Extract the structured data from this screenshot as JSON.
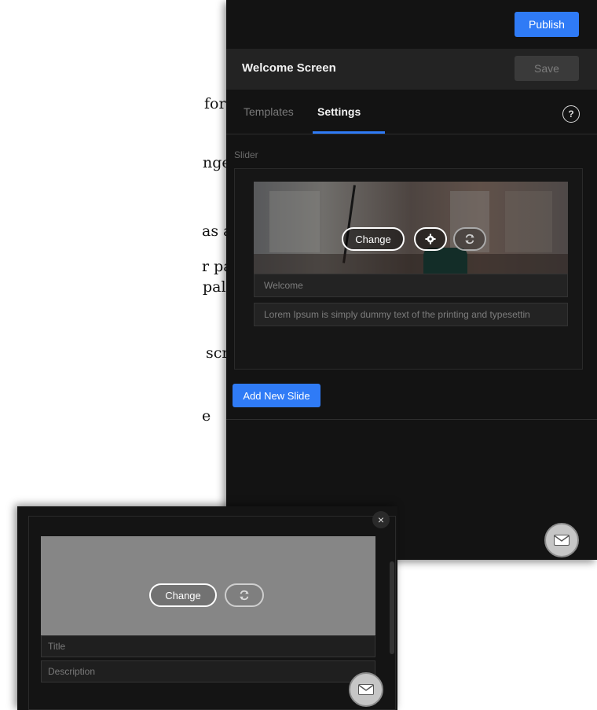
{
  "doc_lines": [
    "for your mobile",
    "nge and the text",
    " as and when",
    "r palette",
    " palette to sync",
    "screen.",
    "e"
  ],
  "main_panel": {
    "publish_label": "Publish",
    "header_title": "Welcome Screen",
    "save_label": "Save",
    "tabs": [
      {
        "label": "Templates",
        "active": false
      },
      {
        "label": "Settings",
        "active": true
      }
    ],
    "help_icon": "?",
    "section_label": "Slider",
    "slide": {
      "change_label": "Change",
      "gear_icon": "gear-icon",
      "refresh_icon": "refresh-icon",
      "title_value": "Welcome",
      "description_value": "Lorem Ipsum is simply dummy text of the printing and typesettin"
    },
    "add_slide_label": "Add New Slide"
  },
  "sub_panel": {
    "close_icon": "×",
    "change_label": "Change",
    "title_placeholder": "Title",
    "description_placeholder": "Description"
  },
  "colors": {
    "accent": "#2f7bf6",
    "panel_bg": "#131313",
    "header_bg": "#232323"
  }
}
